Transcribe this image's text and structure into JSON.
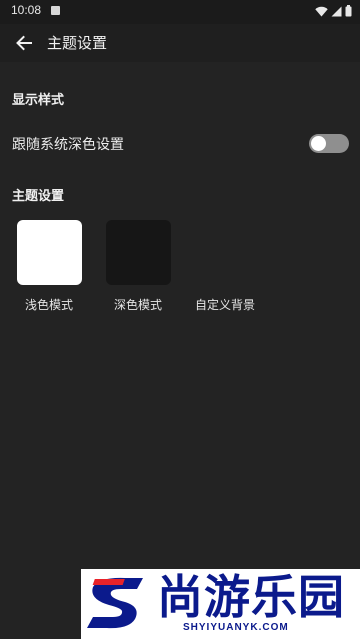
{
  "status_bar": {
    "time": "10:08",
    "icons": [
      "app-notification-icon",
      "wifi-icon",
      "signal-icon",
      "battery-icon"
    ]
  },
  "app_bar": {
    "title": "主题设置",
    "back_icon": "arrow-left-icon"
  },
  "display_section": {
    "title": "显示样式",
    "follow_system_label": "跟随系统深色设置",
    "follow_system_enabled": false
  },
  "theme_section": {
    "title": "主题设置",
    "options": [
      {
        "label": "浅色模式",
        "swatch_color": "#ffffff"
      },
      {
        "label": "深色模式",
        "swatch_color": "#161616"
      },
      {
        "label": "自定义背景",
        "swatch_color": ""
      }
    ]
  },
  "watermark": {
    "logo_text": "尚游乐园",
    "url": "SHYIYUANYK.COM"
  },
  "colors": {
    "background": "#232323",
    "app_bar": "#1f1f1f",
    "toggle_off": "#8f8f8f",
    "brand_blue": "#0b1a8c",
    "brand_red": "#e8232a"
  }
}
